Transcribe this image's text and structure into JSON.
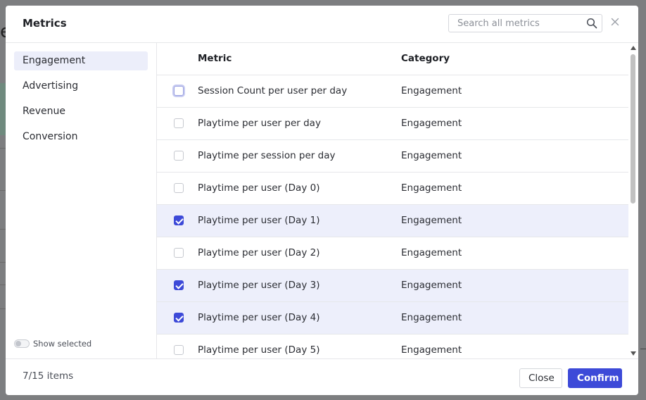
{
  "modal": {
    "title": "Metrics",
    "search_placeholder": "Search all metrics",
    "icons": {
      "search": "search-icon",
      "close": "close-icon"
    }
  },
  "sidebar": {
    "items": [
      {
        "label": "Engagement",
        "active": true
      },
      {
        "label": "Advertising",
        "active": false
      },
      {
        "label": "Revenue",
        "active": false
      },
      {
        "label": "Conversion",
        "active": false
      }
    ],
    "show_selected_label": "Show selected",
    "show_selected_on": false
  },
  "table": {
    "columns": [
      "Metric",
      "Category"
    ],
    "rows": [
      {
        "metric": "Session Count per user per day",
        "category": "Engagement",
        "checked": false,
        "focused": true
      },
      {
        "metric": "Playtime per user per day",
        "category": "Engagement",
        "checked": false
      },
      {
        "metric": "Playtime per session per day",
        "category": "Engagement",
        "checked": false
      },
      {
        "metric": "Playtime per user (Day 0)",
        "category": "Engagement",
        "checked": false
      },
      {
        "metric": "Playtime per user (Day 1)",
        "category": "Engagement",
        "checked": true
      },
      {
        "metric": "Playtime per user (Day 2)",
        "category": "Engagement",
        "checked": false
      },
      {
        "metric": "Playtime per user (Day 3)",
        "category": "Engagement",
        "checked": true
      },
      {
        "metric": "Playtime per user (Day 4)",
        "category": "Engagement",
        "checked": true
      },
      {
        "metric": "Playtime per user (Day 5)",
        "category": "Engagement",
        "checked": false
      }
    ]
  },
  "footer": {
    "count_text": "7/15 items",
    "close_label": "Close",
    "confirm_label": "Confirm"
  },
  "colors": {
    "accent": "#3d4ad8",
    "selected_row": "#edeffb",
    "active_sidebar": "#eceefa"
  }
}
